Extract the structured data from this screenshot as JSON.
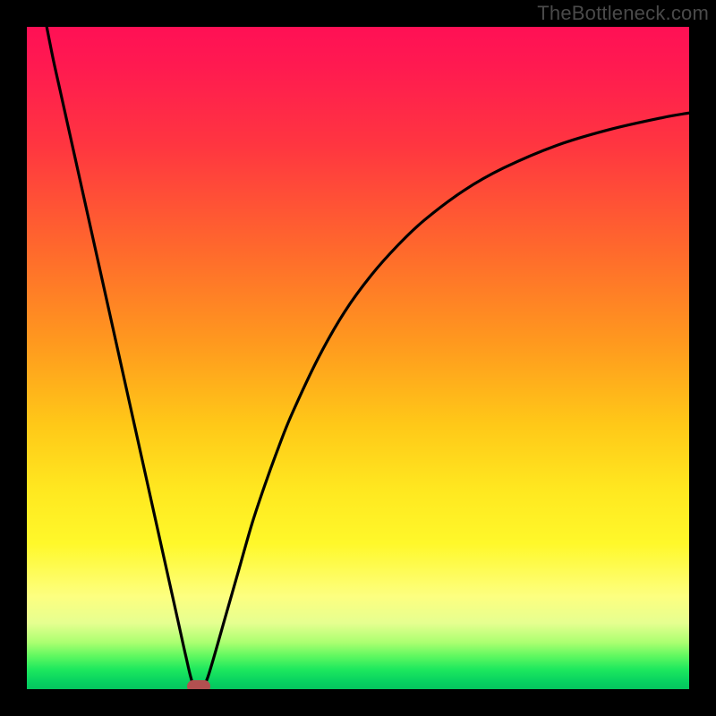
{
  "attribution": "TheBottleneck.com",
  "colors": {
    "page_bg": "#000000",
    "curve": "#000000",
    "marker": "#b25050",
    "gradient_top": "#ff1055",
    "gradient_bottom": "#05c45e"
  },
  "chart_data": {
    "type": "line",
    "title": "",
    "xlabel": "",
    "ylabel": "",
    "xlim": [
      0,
      100
    ],
    "ylim": [
      0,
      100
    ],
    "grid": false,
    "legend": false,
    "x": [
      3,
      4,
      5,
      6,
      8,
      10,
      12,
      14,
      16,
      18,
      20,
      22,
      23,
      24,
      25,
      26,
      27,
      28,
      30,
      32,
      34,
      36,
      38,
      40,
      44,
      48,
      52,
      56,
      60,
      66,
      72,
      80,
      88,
      96,
      100
    ],
    "y": [
      100,
      95,
      90.5,
      86,
      77,
      68,
      59,
      50,
      41,
      32,
      23,
      14,
      9.5,
      5,
      1,
      0,
      1,
      4,
      11,
      18,
      25,
      31,
      36.5,
      41.5,
      50,
      57,
      62.5,
      67,
      70.8,
      75.3,
      78.7,
      82.1,
      84.5,
      86.3,
      87
    ],
    "minimum_marker": {
      "x": 26,
      "y": 0
    },
    "annotations": []
  }
}
